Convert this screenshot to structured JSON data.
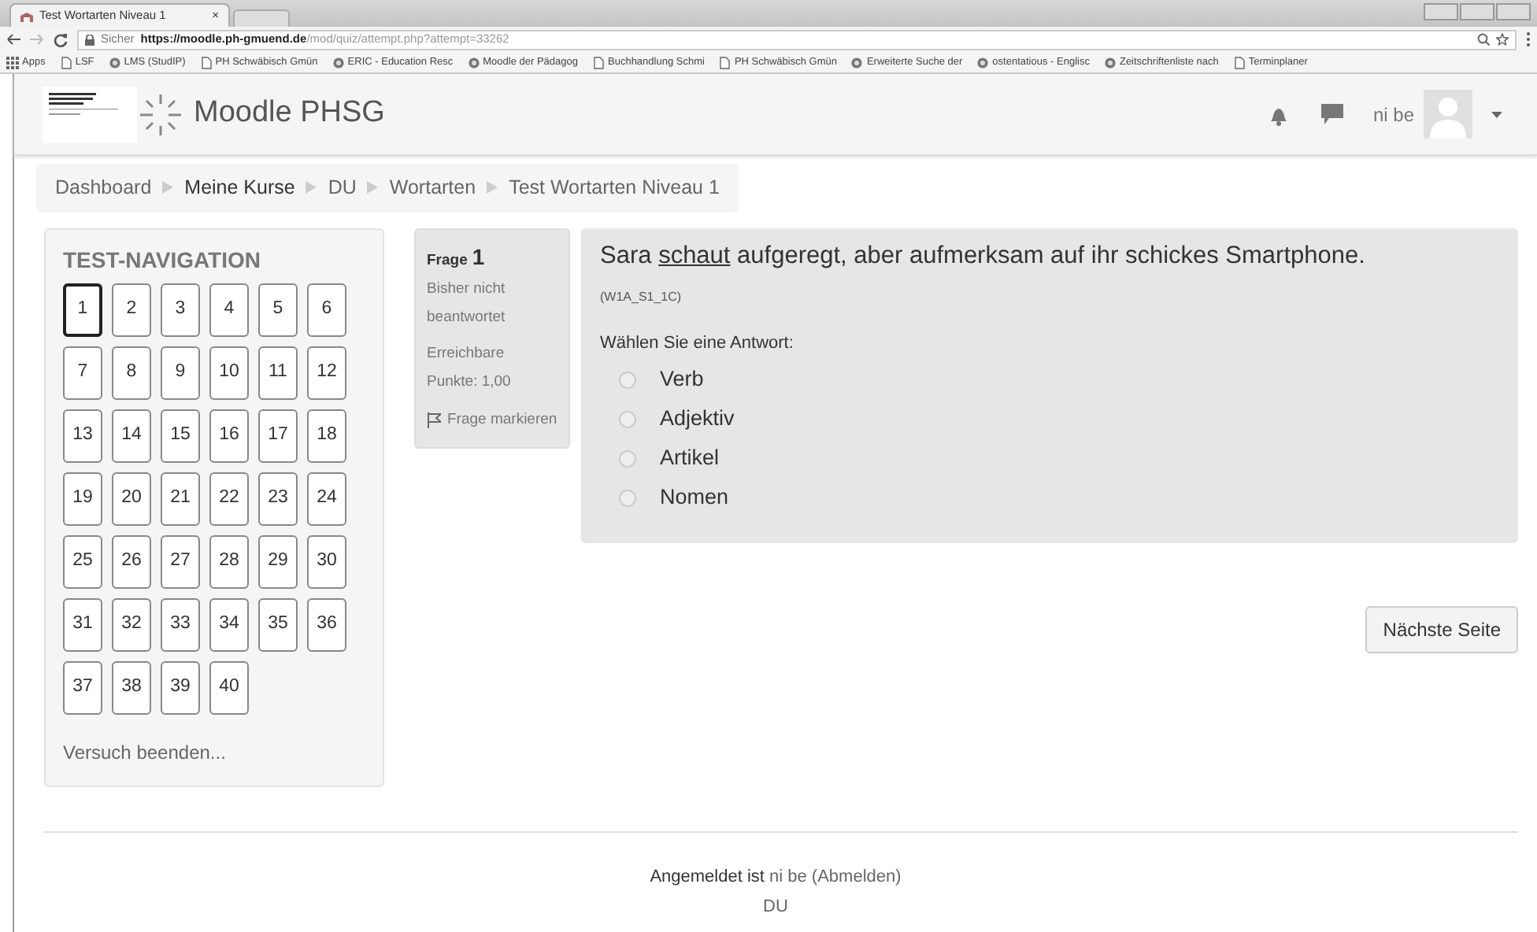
{
  "browser": {
    "tab_title": "Test Wortarten Niveau 1",
    "tab_close": "×",
    "secure_label": "Sicher",
    "url_host": "https://moodle.ph-gmuend.de",
    "url_path": "/mod/quiz/attempt.php?attempt=33262",
    "bookmarks": [
      {
        "label": "Apps",
        "kind": "apps"
      },
      {
        "label": "LSF",
        "kind": "page"
      },
      {
        "label": "LMS (StudIP)",
        "kind": "site"
      },
      {
        "label": "PH Schwäbisch Gmün",
        "kind": "page"
      },
      {
        "label": "ERIC - Education Resc",
        "kind": "site"
      },
      {
        "label": "Moodle der Pädagog",
        "kind": "site"
      },
      {
        "label": "Buchhandlung Schmi",
        "kind": "page"
      },
      {
        "label": "PH Schwäbisch Gmün",
        "kind": "page"
      },
      {
        "label": "Erweiterte Suche der",
        "kind": "site"
      },
      {
        "label": "ostentatious - Englisc",
        "kind": "site"
      },
      {
        "label": "Zeitschriftenliste nach",
        "kind": "site"
      },
      {
        "label": "Terminplaner",
        "kind": "page"
      }
    ]
  },
  "header": {
    "site_name": "Moodle PHSG",
    "user_name": "ni be"
  },
  "breadcrumb": [
    "Dashboard",
    "Meine Kurse",
    "DU",
    "Wortarten",
    "Test Wortarten Niveau 1"
  ],
  "navigation": {
    "title": "TEST-NAVIGATION",
    "questions": [
      {
        "label": "1",
        "current": true
      },
      {
        "label": "2",
        "current": false
      },
      {
        "label": "3",
        "current": false
      },
      {
        "label": "4",
        "current": false
      },
      {
        "label": "5",
        "current": false
      },
      {
        "label": "6",
        "current": false
      },
      {
        "label": "7",
        "current": false
      },
      {
        "label": "8",
        "current": false
      },
      {
        "label": "9",
        "current": false
      },
      {
        "label": "10",
        "current": false
      },
      {
        "label": "11",
        "current": false
      },
      {
        "label": "12",
        "current": false
      },
      {
        "label": "13",
        "current": false
      },
      {
        "label": "14",
        "current": false
      },
      {
        "label": "15",
        "current": false
      },
      {
        "label": "16",
        "current": false
      },
      {
        "label": "17",
        "current": false
      },
      {
        "label": "18",
        "current": false
      },
      {
        "label": "19",
        "current": false
      },
      {
        "label": "20",
        "current": false
      },
      {
        "label": "21",
        "current": false
      },
      {
        "label": "22",
        "current": false
      },
      {
        "label": "23",
        "current": false
      },
      {
        "label": "24",
        "current": false
      },
      {
        "label": "25",
        "current": false
      },
      {
        "label": "26",
        "current": false
      },
      {
        "label": "27",
        "current": false
      },
      {
        "label": "28",
        "current": false
      },
      {
        "label": "29",
        "current": false
      },
      {
        "label": "30",
        "current": false
      },
      {
        "label": "31",
        "current": false
      },
      {
        "label": "32",
        "current": false
      },
      {
        "label": "33",
        "current": false
      },
      {
        "label": "34",
        "current": false
      },
      {
        "label": "35",
        "current": false
      },
      {
        "label": "36",
        "current": false
      },
      {
        "label": "37",
        "current": false
      },
      {
        "label": "38",
        "current": false
      },
      {
        "label": "39",
        "current": false
      },
      {
        "label": "40",
        "current": false
      }
    ],
    "finish_link": "Versuch beenden..."
  },
  "question_info": {
    "label": "Frage",
    "number": "1",
    "status": "Bisher nicht beantwortet",
    "points": "Erreichbare Punkte: 1,00",
    "flag_label": "Frage markieren"
  },
  "question": {
    "text": [
      {
        "text": "Sara ",
        "underline": false
      },
      {
        "text": "schaut",
        "underline": true
      },
      {
        "text": " aufgeregt, aber aufmerksam auf ihr schickes Smartphone.",
        "underline": false
      }
    ],
    "code": "(W1A_S1_1C)",
    "prompt": "Wählen Sie eine Antwort:",
    "options": [
      {
        "label": "Verb",
        "selected": false
      },
      {
        "label": "Adjektiv",
        "selected": false
      },
      {
        "label": "Artikel",
        "selected": false
      },
      {
        "label": "Nomen",
        "selected": false
      }
    ]
  },
  "next_button": "Nächste Seite",
  "footer": {
    "logged_in_label": "Angemeldet ist",
    "user_name": "ni be",
    "logout": "(Abmelden)",
    "course": "DU"
  }
}
